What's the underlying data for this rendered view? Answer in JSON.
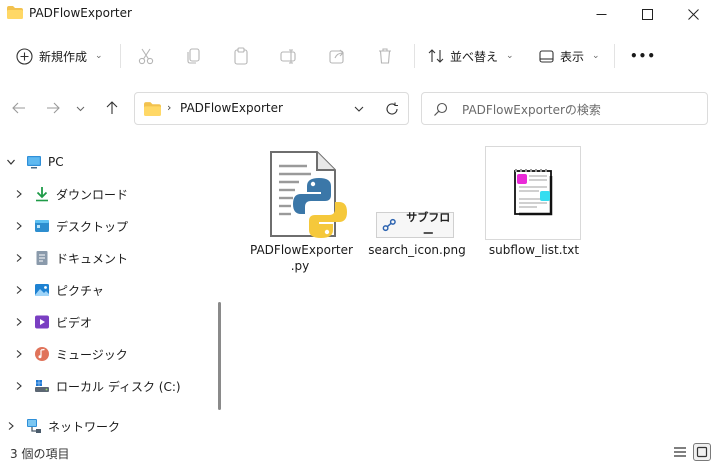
{
  "window": {
    "title": "PADFlowExporter",
    "minimize_icon": "minimize-icon",
    "maximize_icon": "maximize-icon",
    "close_icon": "close-icon"
  },
  "toolbar": {
    "new_label": "新規作成",
    "sort_label": "並べ替え",
    "view_label": "表示",
    "more_label": "•••"
  },
  "address": {
    "path_segment": "PADFlowExporter",
    "separator": "›"
  },
  "search": {
    "placeholder": "PADFlowExporterの検索"
  },
  "nav": {
    "items": [
      {
        "label": "PC",
        "icon": "pc-icon"
      },
      {
        "label": "ダウンロード",
        "icon": "download-icon"
      },
      {
        "label": "デスクトップ",
        "icon": "desktop-icon"
      },
      {
        "label": "ドキュメント",
        "icon": "document-icon"
      },
      {
        "label": "ピクチャ",
        "icon": "pictures-icon"
      },
      {
        "label": "ビデオ",
        "icon": "video-icon"
      },
      {
        "label": "ミュージック",
        "icon": "music-icon"
      },
      {
        "label": "ローカル ディスク (C:)",
        "icon": "disk-icon"
      },
      {
        "label": "ネットワーク",
        "icon": "network-icon"
      }
    ]
  },
  "files": [
    {
      "name_line1": "PADFlowExporter",
      "name_line2": ".py",
      "icon": "python-file-icon"
    },
    {
      "name_line1": "search_icon.png",
      "thumb_text": "サブフロー",
      "icon": "image-thumbnail-icon"
    },
    {
      "name_line1": "subflow_list.txt",
      "icon": "text-file-icon"
    }
  ],
  "status": {
    "item_count": "3 個の項目"
  },
  "colors": {
    "accent": "#0067c0",
    "folder": "#f2c24f",
    "python_blue": "#3b77a8",
    "python_yellow": "#f5c83b"
  }
}
